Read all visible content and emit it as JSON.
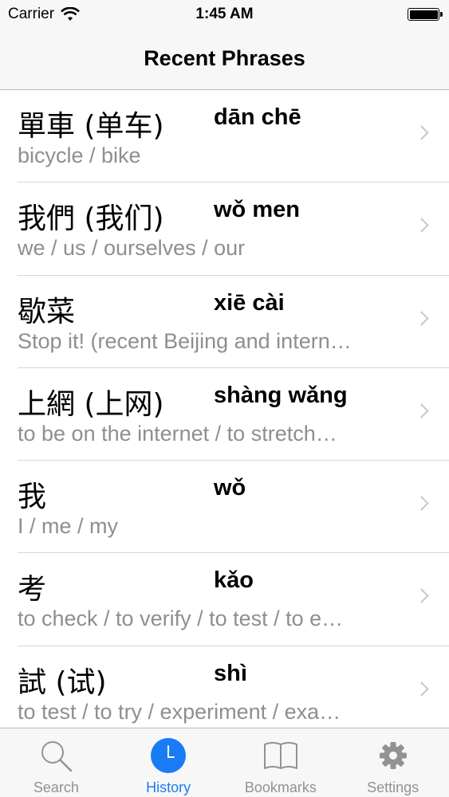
{
  "status_bar": {
    "carrier": "Carrier",
    "time": "1:45 AM"
  },
  "nav": {
    "title": "Recent Phrases"
  },
  "phrases": [
    {
      "hanzi": "單車 (单车)",
      "pinyin": "dān chē",
      "gloss": "bicycle / bike"
    },
    {
      "hanzi": "我們 (我们)",
      "pinyin": "wǒ men",
      "gloss": "we / us / ourselves / our"
    },
    {
      "hanzi": "歇菜",
      "pinyin": "xiē cài",
      "gloss": "Stop it! (recent Beijing and intern…"
    },
    {
      "hanzi": "上網 (上网)",
      "pinyin": "shàng wǎng",
      "gloss": "to be on the internet / to stretch…"
    },
    {
      "hanzi": "我",
      "pinyin": "wǒ",
      "gloss": "I / me / my"
    },
    {
      "hanzi": "考",
      "pinyin": "kǎo",
      "gloss": "to check / to verify / to test / to e…"
    },
    {
      "hanzi": "試 (试)",
      "pinyin": "shì",
      "gloss": "to test / to try / experiment / exa…"
    }
  ],
  "tabs": [
    {
      "label": "Search",
      "icon": "search-icon"
    },
    {
      "label": "History",
      "icon": "clock-icon",
      "active": true
    },
    {
      "label": "Bookmarks",
      "icon": "book-icon"
    },
    {
      "label": "Settings",
      "icon": "gear-icon"
    }
  ],
  "colors": {
    "accent": "#1a7cf5",
    "inactive": "#929292",
    "secondary_text": "#8e8e93"
  }
}
